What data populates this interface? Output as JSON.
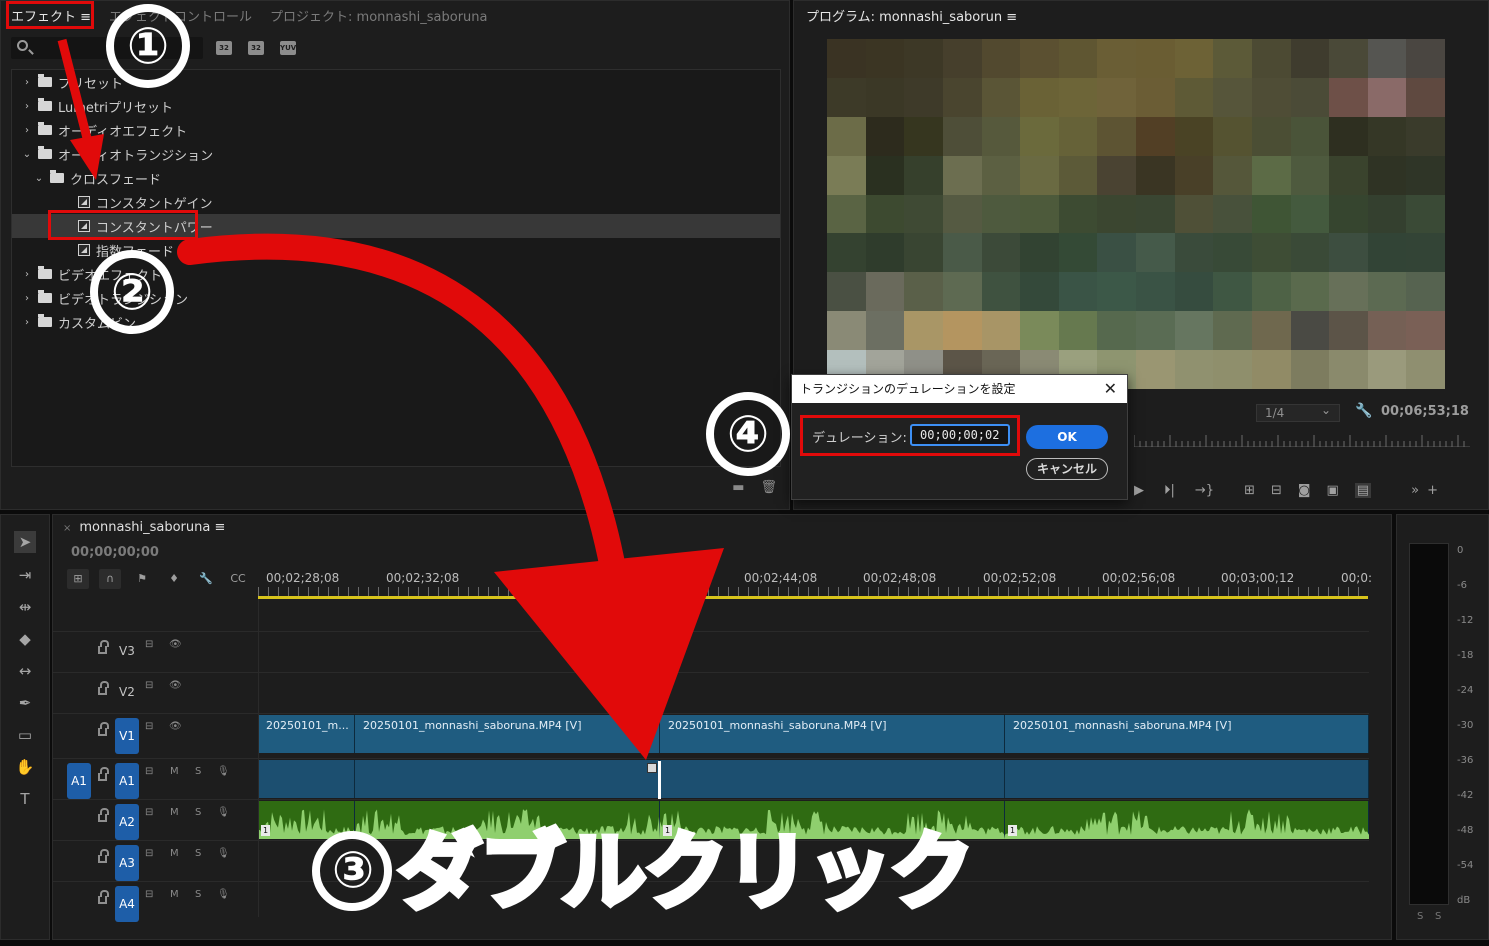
{
  "effects_panel": {
    "tabs": [
      "エフェクト ≡",
      "エフェクトコントロール",
      "プロジェクト: monnashi_saboruna"
    ],
    "fx_buttons": [
      "32",
      "32",
      "YUV"
    ],
    "tree": [
      {
        "label": "プリセット",
        "level": 0,
        "type": "folder",
        "expanded": false
      },
      {
        "label": "Lumetriプリセット",
        "level": 0,
        "type": "folder",
        "expanded": false
      },
      {
        "label": "オーディオエフェクト",
        "level": 0,
        "type": "folder",
        "expanded": false
      },
      {
        "label": "オーディオトランジション",
        "level": 0,
        "type": "folder",
        "expanded": true
      },
      {
        "label": "クロスフェード",
        "level": 1,
        "type": "folder",
        "expanded": true
      },
      {
        "label": "コンスタントゲイン",
        "level": 2,
        "type": "effect"
      },
      {
        "label": "コンスタントパワー",
        "level": 2,
        "type": "effect",
        "selected": true
      },
      {
        "label": "指数フェード",
        "level": 2,
        "type": "effect"
      },
      {
        "label": "ビデオエフェクト",
        "level": 0,
        "type": "folder",
        "expanded": false
      },
      {
        "label": "ビデオトランジション",
        "level": 0,
        "type": "folder",
        "expanded": false
      },
      {
        "label": "カスタムビン",
        "level": 0,
        "type": "folder",
        "expanded": false
      }
    ]
  },
  "program_monitor": {
    "title": "プログラム: monnashi_saborun ≡",
    "zoom": "1/4",
    "timecode": "00;06;53;18",
    "frame_colors": [
      "#3a3323",
      "#3b3523",
      "#3d3826",
      "#463f2c",
      "#52492f",
      "#5b5031",
      "#5f5632",
      "#6a5e35",
      "#6a5d33",
      "#6d6236",
      "#5c5a38",
      "#4c4a33",
      "#3f3c2e",
      "#4a4938",
      "#555551",
      "#4a4641",
      "#3d3a28",
      "#3b3826",
      "#3e3a29",
      "#4a452f",
      "#5a5536",
      "#6a6236",
      "#6d6538",
      "#70633a",
      "#6b5d35",
      "#5e5a36",
      "#56553a",
      "#4f4d36",
      "#4b4b37",
      "#6e5048",
      "#8a6a68",
      "#5f4940",
      "#6c6c48",
      "#2d2b1d",
      "#36361f",
      "#4e4e38",
      "#56593c",
      "#6b6a3c",
      "#666238",
      "#5d5433",
      "#523f25",
      "#4a4325",
      "#555331",
      "#4b4e34",
      "#4a5439",
      "#2e2f20",
      "#353726",
      "#3a3b2b",
      "#7a7c56",
      "#2a3020",
      "#36402c",
      "#6c6e50",
      "#5c6042",
      "#6a6a42",
      "#5c5a38",
      "#4a4332",
      "#3a3523",
      "#494028",
      "#55573a",
      "#5c6b46",
      "#4e5a3e",
      "#3a432d",
      "#2f3324",
      "#2f3527",
      "#5a6444",
      "#3d4a30",
      "#3f4a34",
      "#555a42",
      "#4e5a3e",
      "#4d5a3b",
      "#3d4b32",
      "#3b4630",
      "#3a4632",
      "#4f5037",
      "#48513b",
      "#3f5535",
      "#445a3e",
      "#36452f",
      "#34402f",
      "#3a4a36",
      "#344230",
      "#2f3c2c",
      "#394532",
      "#4a5a48",
      "#3c4a39",
      "#324332",
      "#344a36",
      "#3a5044",
      "#455a4a",
      "#3a4b3b",
      "#384a37",
      "#3e4d35",
      "#3a4a37",
      "#3d4e40",
      "#324436",
      "#334436",
      "#4a5043",
      "#6a6a5c",
      "#5a6049",
      "#5e6a52",
      "#3f5240",
      "#34493a",
      "#3a5446",
      "#3c5848",
      "#3a5345",
      "#364c3f",
      "#3f5743",
      "#4e6246",
      "#5a6a4d",
      "#677059",
      "#5c6a52",
      "#566350",
      "#8a8a76",
      "#6c6f62",
      "#a99666",
      "#b49560",
      "#a89566",
      "#7a8a5a",
      "#66794f",
      "#56694e",
      "#5a6c54",
      "#667660",
      "#5f6a50",
      "#6f684e",
      "#4a4a44",
      "#5c5448",
      "#756055",
      "#7a6056",
      "#b3bfbd",
      "#a2a49a",
      "#8f9088",
      "#5c5548",
      "#6a6656",
      "#8a8a74",
      "#9aa07e",
      "#8e9570",
      "#9a9672",
      "#90916f",
      "#8f8f6c",
      "#918b66",
      "#7d7c5f",
      "#8a8a6c",
      "#9a9a7c",
      "#8f8f70"
    ]
  },
  "dialog": {
    "title": "トランジションのデュレーションを設定",
    "label": "デュレーション:",
    "value": "00;00;00;02",
    "ok": "OK",
    "cancel": "キャンセル"
  },
  "timeline": {
    "sequence_name": "monnashi_saboruna",
    "playhead_timecode": "00;00;00;00",
    "ruler_labels": [
      "00;02;28;08",
      "00;02;32;08",
      "00;02;44;08",
      "00;02;48;08",
      "00;02;52;08",
      "00;02;56;08",
      "00;03;00;12",
      "00;0:"
    ],
    "tracks": [
      {
        "name": "V3",
        "type": "video"
      },
      {
        "name": "V2",
        "type": "video"
      },
      {
        "name": "V1",
        "type": "video",
        "targeted": true
      },
      {
        "name": "A1",
        "type": "audio",
        "targeted": true,
        "source": "A1"
      },
      {
        "name": "A2",
        "type": "audio",
        "targeted": true
      },
      {
        "name": "A3",
        "type": "audio",
        "targeted": true
      },
      {
        "name": "A4",
        "type": "audio",
        "targeted": true
      }
    ],
    "audio_toggles": {
      "mute": "M",
      "solo": "S"
    },
    "video_clips": [
      "20250101_m...",
      "20250101_monnashi_saboruna.MP4 [V]",
      "20250101_monnashi_saboruna.MP4 [V]",
      "20250101_monnashi_saboruna.MP4 [V]"
    ],
    "clip_number": "1"
  },
  "meter": {
    "scale": [
      "0",
      "-6",
      "-12",
      "-18",
      "-24",
      "-30",
      "-36",
      "-42",
      "-48",
      "-54",
      "dB"
    ],
    "solo_labels": [
      "S",
      "S"
    ]
  },
  "annotations": {
    "step1": "①",
    "step2": "②",
    "step4": "④",
    "step3_circle": "③",
    "step3_text": "ダブルクリック",
    "accent": "#e10a0a"
  }
}
